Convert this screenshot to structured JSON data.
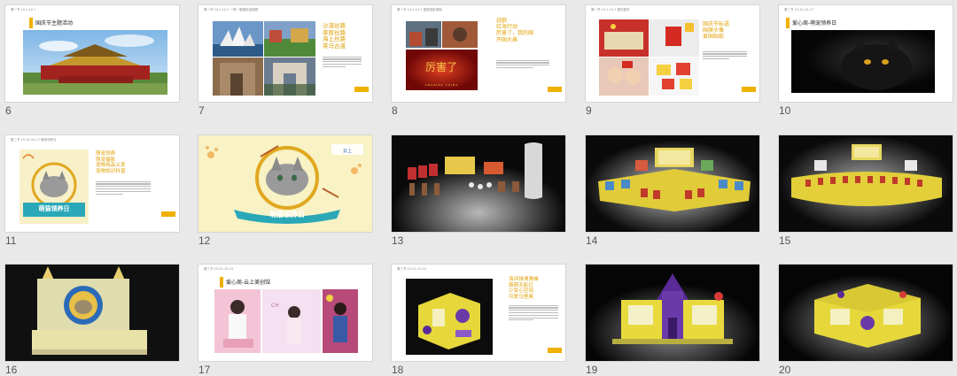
{
  "slides": [
    {
      "num": "6",
      "header": "第一节  10.1-10.7",
      "title": "国庆节主题活动"
    },
    {
      "num": "7",
      "header": "第一节  10.1-10.7  一带一路国际游观展",
      "title_lines": [
        "沙漠丝路",
        "草原丝路",
        "海上丝路",
        "茶马古道"
      ]
    },
    {
      "num": "8",
      "header": "第一节  10.1-10.7  爱国电影观映",
      "title_lines": [
        "战狼",
        "红海行动",
        "厉害了，我的国",
        "开国大典"
      ],
      "poster_text": "AMAZING CHINA"
    },
    {
      "num": "9",
      "header": "第一节  10.1-10.7  国庆嘉年",
      "title_lines": [
        "国庆节标语",
        "国旗头像",
        "爱国贴纸"
      ]
    },
    {
      "num": "10",
      "header": "第二节  10.15-10.17",
      "title": "爱心周-萌宠领养日"
    },
    {
      "num": "11",
      "header": "第二节  10.15-10.17  萌宠领养日",
      "title_lines": [
        "萌宠领养",
        "萌宠摄影",
        "宠物用品义卖",
        "宠物知识科普"
      ],
      "banner": "萌猫领养日"
    },
    {
      "num": "12",
      "banner": "萌猫领养日"
    },
    {
      "num": "13"
    },
    {
      "num": "14"
    },
    {
      "num": "15"
    },
    {
      "num": "16"
    },
    {
      "num": "17",
      "header": "第三节  10.22-10.24",
      "title": "爱心周-云上美创馆"
    },
    {
      "num": "18",
      "header": "第三节  10.22-10.24",
      "title_lines": [
        "海洋球滑滑梯",
        "萌萌无影灯",
        "少女心空间",
        "可爱马里奥"
      ]
    },
    {
      "num": "19"
    },
    {
      "num": "20"
    }
  ],
  "colors": {
    "accent": "#f0b000",
    "background": "#e9e9e9",
    "slide": "#ffffff"
  }
}
